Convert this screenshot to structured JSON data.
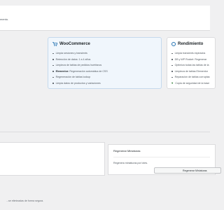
{
  "notice": {
    "text": "mento."
  },
  "woocommerce": {
    "title": "WooCommerce",
    "items": [
      {
        "bold": "",
        "text": "Limpia sesiones y transients"
      },
      {
        "bold": "",
        "text": "Retención de datos: 1 a 4 años"
      },
      {
        "bold": "",
        "text": "Limpieza de tablas de pedidos huérfanos"
      },
      {
        "bold": "Elementor:",
        "text": " Regeneración automática de CSS"
      },
      {
        "bold": "",
        "text": "Regeneración de tablas lookup"
      },
      {
        "bold": "",
        "text": "Limpia datos de productos y variaciones"
      }
    ]
  },
  "rendimiento": {
    "title": "Rendimiento",
    "items": [
      {
        "text": "Limpia transients expirados"
      },
      {
        "text": "DB y WP Rocket: Regenerar"
      },
      {
        "text": "Optimiza todas las tablas de la"
      },
      {
        "text": "Limpieza de tablas Elementor"
      },
      {
        "text": "Reparación de tablas corruptas"
      },
      {
        "text": "Copia de seguridad de la base"
      }
    ]
  },
  "regenerar": {
    "title": "Regenerar Miniaturas",
    "description": "Regenera miniaturas por lotes.",
    "button_label": "Regenerar Miniaturas"
  },
  "footer": {
    "note": "...se eliminadas de forma segura."
  },
  "colors": {
    "accent": "#2271b1",
    "shield": "#2e7d32"
  }
}
